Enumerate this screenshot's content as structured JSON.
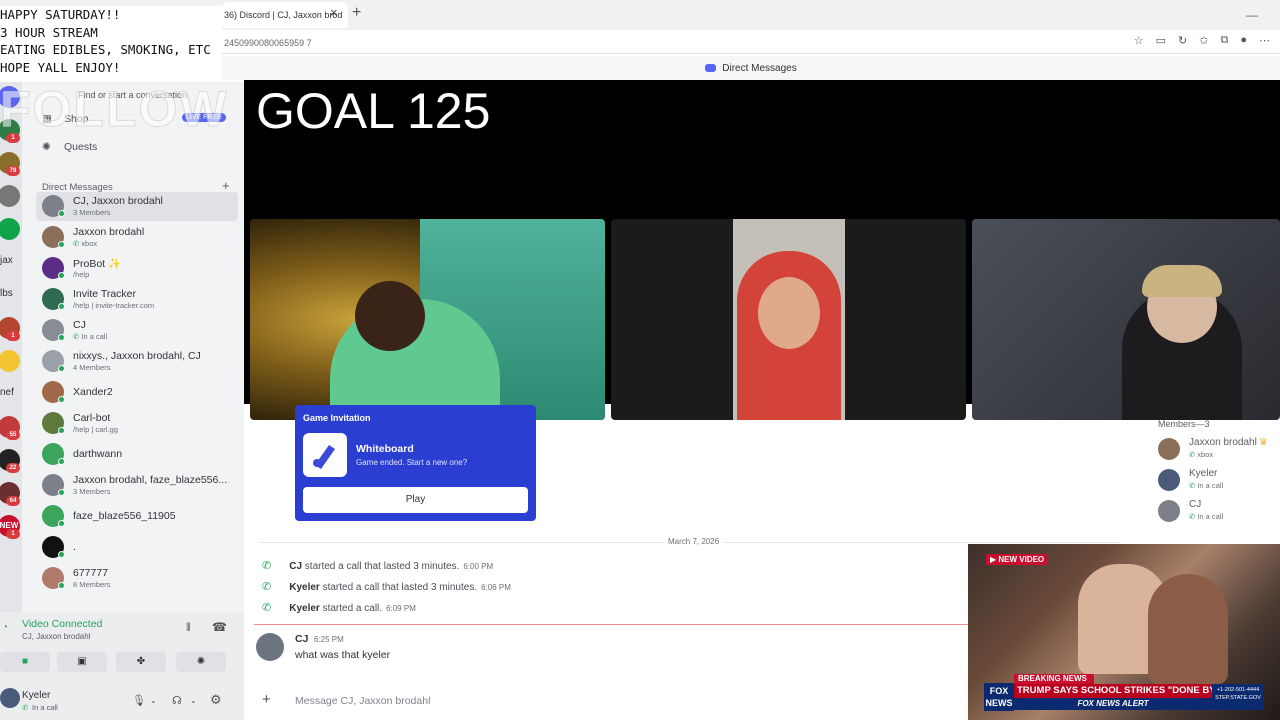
{
  "overlay": {
    "lines": [
      "HAPPY SATURDAY!!",
      "3 HOUR STREAM",
      "EATING EDIBLES, SMOKING, ETC",
      "HOPE YALL ENJOY!"
    ]
  },
  "browser": {
    "tab_title": "36) Discord | CJ, Jaxxon brod",
    "url": "2450990080065959 7",
    "page_title": "Direct Messages"
  },
  "stream_overlay": {
    "follow_text": "FOLLOW",
    "goal_text": "GOAL 125"
  },
  "sidebar": {
    "find_placeholder": "Find or start a conversation",
    "shop_label": "Shop",
    "shop_badge": "LIVE FREE",
    "quests_label": "Quests",
    "dm_header": "Direct Messages",
    "dms": [
      {
        "name": "CJ, Jaxxon brodahl",
        "sub": "3 Members",
        "color": "#7d8088",
        "active": true
      },
      {
        "name": "Jaxxon brodahl",
        "sub": "xbox",
        "call": true,
        "color": "#8a6f5a"
      },
      {
        "name": "ProBot ✨",
        "sub": "/help",
        "color": "#5b2d86"
      },
      {
        "name": "Invite Tracker",
        "sub": "/help | invite-tracker.com",
        "color": "#2e6b4f"
      },
      {
        "name": "CJ",
        "sub": "In a call",
        "call": true,
        "color": "#888c94"
      },
      {
        "name": "nixxys., Jaxxon brodahl, CJ",
        "sub": "4 Members",
        "color": "#9aa0a8"
      },
      {
        "name": "Xander2",
        "sub": "",
        "color": "#a06a4a"
      },
      {
        "name": "Carl-bot",
        "sub": "/help | carl.gg",
        "color": "#5c7a3a"
      },
      {
        "name": "darthwann",
        "sub": "",
        "color": "#3ba55c"
      },
      {
        "name": "Jaxxon brodahl, faze_blaze556...",
        "sub": "3 Members",
        "color": "#7d8088"
      },
      {
        "name": "faze_blaze556_11905",
        "sub": "",
        "color": "#3ba55c"
      },
      {
        "name": ".",
        "sub": "",
        "color": "#111111"
      },
      {
        "name": "677777",
        "sub": "8 Members",
        "color": "#b07a6a"
      }
    ]
  },
  "servers": [
    {
      "label": "",
      "color": "#5865f2",
      "badge": ""
    },
    {
      "label": "",
      "color": "#2d7d46",
      "badge": "1"
    },
    {
      "label": "",
      "color": "#8a6f2a",
      "badge": "78"
    },
    {
      "label": "",
      "color": "#777777",
      "badge": ""
    },
    {
      "label": "",
      "color": "#0fa34a",
      "badge": ""
    },
    {
      "label": "jax",
      "color": "",
      "badge": ""
    },
    {
      "label": "lbs",
      "color": "",
      "badge": ""
    },
    {
      "label": "",
      "color": "#b4452e",
      "badge": "1"
    },
    {
      "label": "",
      "color": "#f2c531",
      "badge": ""
    },
    {
      "label": "nef",
      "color": "",
      "badge": ""
    },
    {
      "label": "",
      "color": "#c23b3b",
      "badge": "55"
    },
    {
      "label": "",
      "color": "#222222",
      "badge": "22"
    },
    {
      "label": "",
      "color": "#6b2f2f",
      "badge": "64"
    },
    {
      "label": "NEW",
      "color": "#c8102e",
      "badge": "1"
    }
  ],
  "voice": {
    "title": "Video Connected",
    "sub": "CJ, Jaxxon brodahl",
    "user_name": "Kyeler",
    "user_status": "In a call"
  },
  "game": {
    "header": "Game Invitation",
    "name": "Whiteboard",
    "sub": "Game ended. Start a new one?",
    "play": "Play"
  },
  "members": {
    "title": "Members—3",
    "list": [
      {
        "name": "Jaxxon brodahl",
        "crown": "♛",
        "sub": "xbox",
        "color": "#8a6f5a"
      },
      {
        "name": "Kyeler",
        "sub": "In a call",
        "color": "#4a5a7a"
      },
      {
        "name": "CJ",
        "sub": "In a call",
        "color": "#7d8088"
      }
    ]
  },
  "chat": {
    "date": "March 7, 2026",
    "system": [
      {
        "author": "CJ",
        "text": " started a call that lasted 3 minutes.",
        "time": "6:00 PM"
      },
      {
        "author": "Kyeler",
        "text": " started a call that lasted 3 minutes.",
        "time": "6:06 PM"
      },
      {
        "author": "Kyeler",
        "text": " started a call.",
        "time": "6:09 PM"
      }
    ],
    "message": {
      "author": "CJ",
      "time": "6:25 PM",
      "text": "what was that kyeler"
    },
    "input_placeholder": "Message CJ, Jaxxon brodahl"
  },
  "news": {
    "badge": "▶ NEW VIDEO",
    "breaking": "BREAKING NEWS",
    "headline": "TRUMP SAYS SCHOOL STRIKES \"DONE BY IRAN\"",
    "alert": "FOX NEWS ALERT",
    "logo": "FOX NEWS",
    "phone": "+1-202-501-4444 STEP.STATE.GOV"
  }
}
